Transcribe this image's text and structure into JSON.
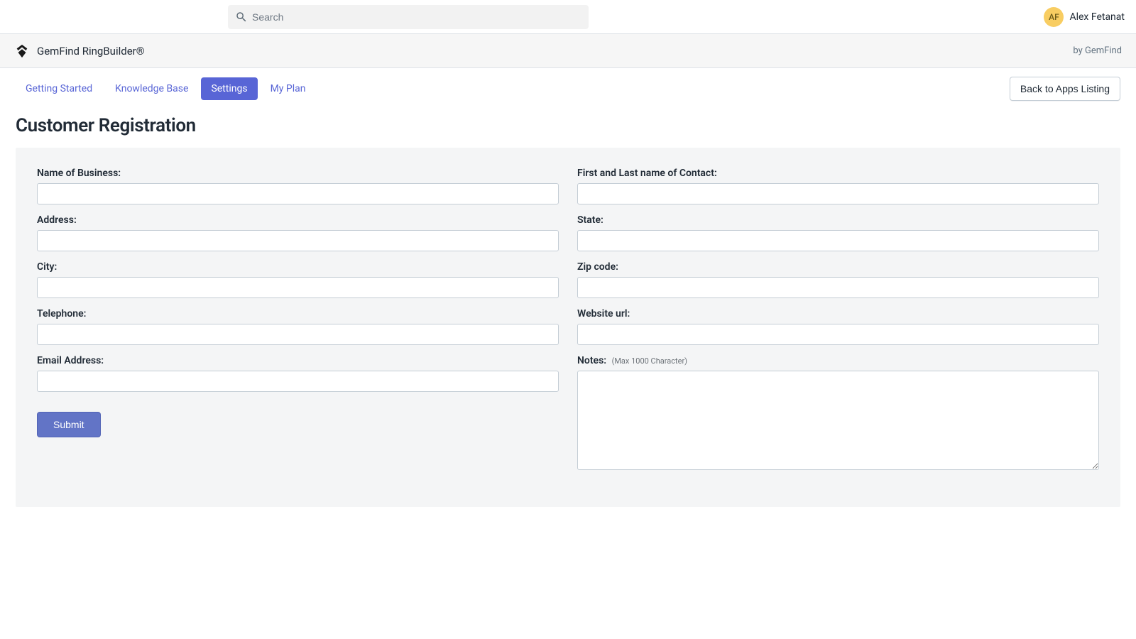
{
  "topbar": {
    "search_placeholder": "Search",
    "avatar_initials": "AF",
    "user_name": "Alex Fetanat"
  },
  "appbar": {
    "app_title": "GemFind RingBuilder®",
    "by_line": "by GemFind"
  },
  "nav": {
    "tabs": [
      {
        "label": "Getting Started",
        "active": false
      },
      {
        "label": "Knowledge Base",
        "active": false
      },
      {
        "label": "Settings",
        "active": true
      },
      {
        "label": "My Plan",
        "active": false
      }
    ],
    "back_button": "Back to Apps Listing"
  },
  "page": {
    "title": "Customer Registration"
  },
  "form": {
    "left": {
      "business_label": "Name of Business:",
      "business_value": "",
      "address_label": "Address:",
      "address_value": "",
      "city_label": "City:",
      "city_value": "",
      "telephone_label": "Telephone:",
      "telephone_value": "",
      "email_label": "Email Address:",
      "email_value": ""
    },
    "right": {
      "contact_label": "First and Last name of Contact:",
      "contact_value": "",
      "state_label": "State:",
      "state_value": "",
      "zip_label": "Zip code:",
      "zip_value": "",
      "website_label": "Website url:",
      "website_value": "",
      "notes_label": "Notes:",
      "notes_hint": "(Max 1000 Character)",
      "notes_value": ""
    },
    "submit_label": "Submit"
  }
}
